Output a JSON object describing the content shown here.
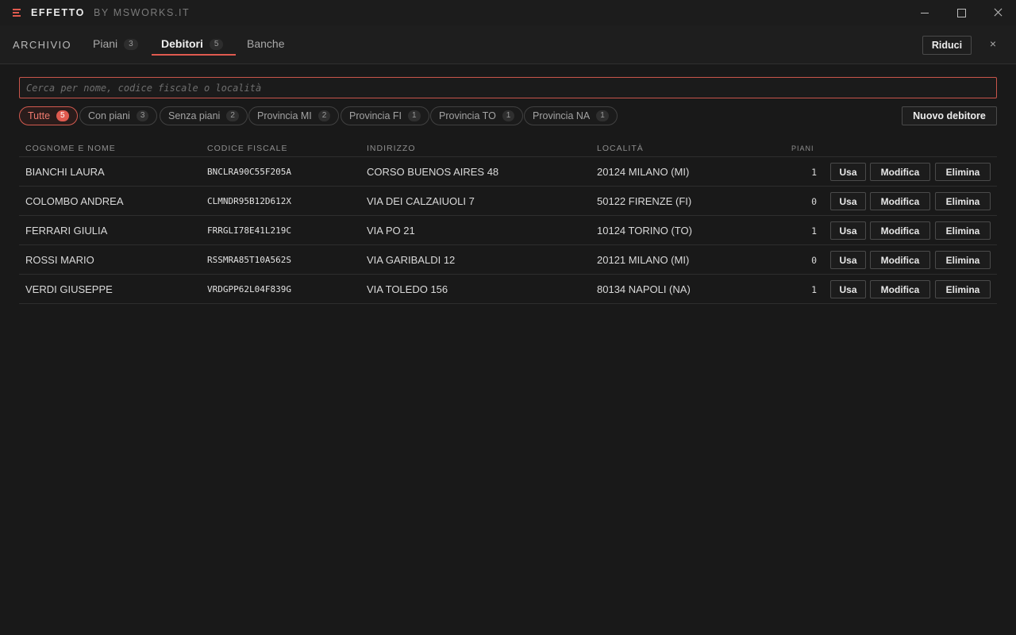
{
  "titlebar": {
    "app_name": "EFFETTO",
    "app_by": "BY MSWORKS.IT"
  },
  "nav": {
    "section": "ARCHIVIO",
    "tabs": [
      {
        "label": "Piani",
        "count": "3"
      },
      {
        "label": "Debitori",
        "count": "5",
        "active": true
      },
      {
        "label": "Banche"
      }
    ],
    "reduce_label": "Riduci",
    "close_glyph": "×"
  },
  "search": {
    "placeholder": "Cerca per nome, codice fiscale o località",
    "value": ""
  },
  "filters": [
    {
      "label": "Tutte",
      "count": "5",
      "active": true
    },
    {
      "label": "Con piani",
      "count": "3"
    },
    {
      "label": "Senza piani",
      "count": "2"
    },
    {
      "label": "Provincia MI",
      "count": "2"
    },
    {
      "label": "Provincia FI",
      "count": "1"
    },
    {
      "label": "Provincia TO",
      "count": "1"
    },
    {
      "label": "Provincia NA",
      "count": "1"
    }
  ],
  "new_debtor_label": "Nuovo debitore",
  "table": {
    "headers": {
      "name": "COGNOME E NOME",
      "cf": "CODICE FISCALE",
      "address": "INDIRIZZO",
      "city": "LOCALITÀ",
      "plans": "PIANI"
    },
    "actions": {
      "use": "Usa",
      "edit": "Modifica",
      "delete": "Elimina"
    },
    "rows": [
      {
        "name": "BIANCHI LAURA",
        "cf": "BNCLRA90C55F205A",
        "address": "CORSO BUENOS AIRES 48",
        "city": "20124 MILANO (MI)",
        "plans": "1"
      },
      {
        "name": "COLOMBO ANDREA",
        "cf": "CLMNDR95B12D612X",
        "address": "VIA DEI CALZAIUOLI 7",
        "city": "50122 FIRENZE (FI)",
        "plans": "0"
      },
      {
        "name": "FERRARI GIULIA",
        "cf": "FRRGLI78E41L219C",
        "address": "VIA PO 21",
        "city": "10124 TORINO (TO)",
        "plans": "1"
      },
      {
        "name": "ROSSI MARIO",
        "cf": "RSSMRA85T10A562S",
        "address": "VIA GARIBALDI 12",
        "city": "20121 MILANO (MI)",
        "plans": "0"
      },
      {
        "name": "VERDI GIUSEPPE",
        "cf": "VRDGPP62L04F839G",
        "address": "VIA TOLEDO 156",
        "city": "80134 NAPOLI (NA)",
        "plans": "1"
      }
    ]
  },
  "colors": {
    "accent": "#e05a4f",
    "background": "#191919"
  }
}
